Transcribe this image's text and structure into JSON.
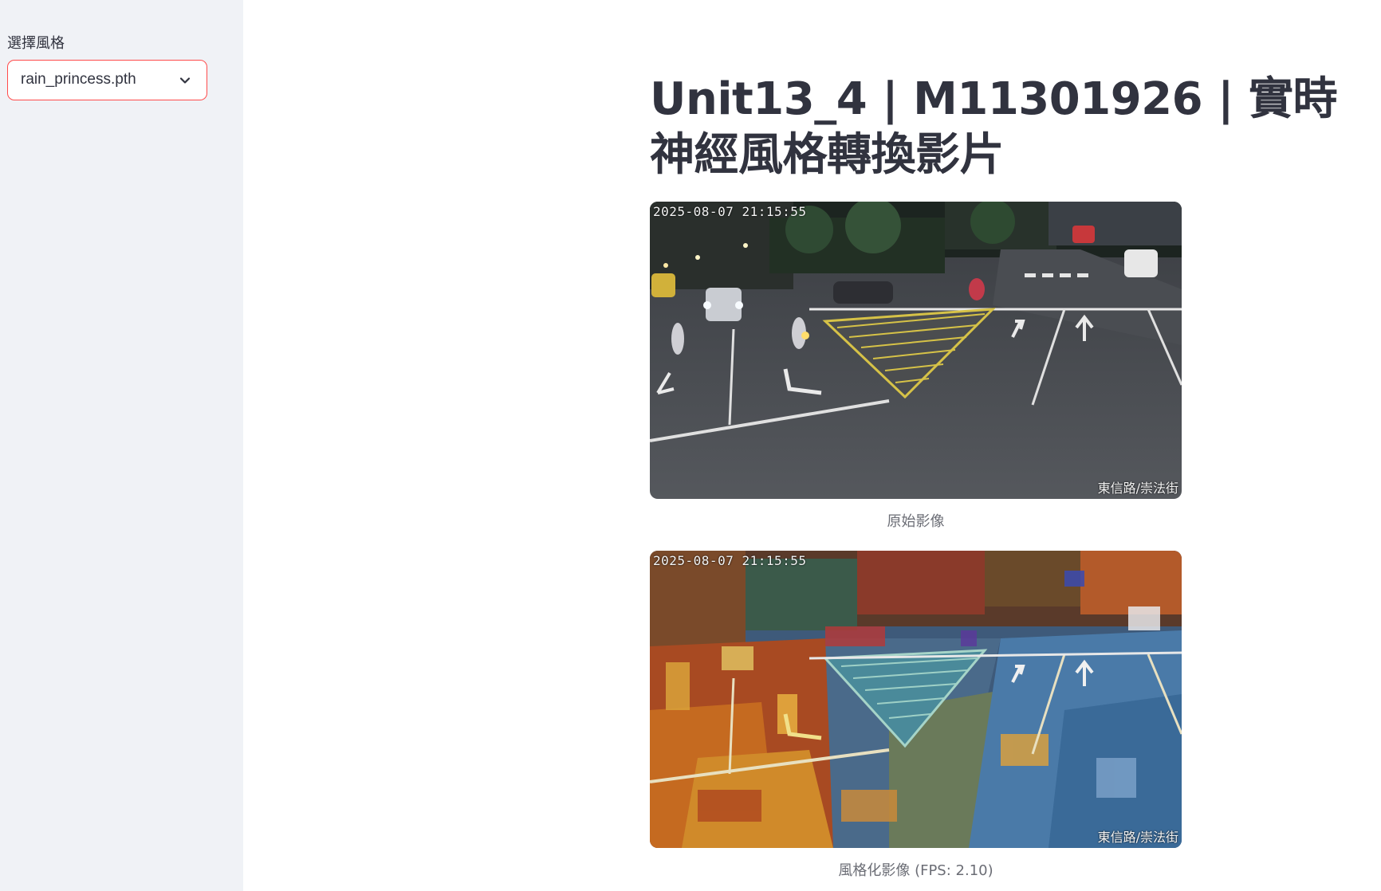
{
  "sidebar": {
    "label": "選擇風格",
    "select": {
      "value": "rain_princess.pth",
      "icon": "chevron-down-icon"
    }
  },
  "main": {
    "title": "Unit13_4 | M11301926 | 實時神經風格轉換影片",
    "original": {
      "timestamp": "2025-08-07  21:15:55",
      "location": "東信路/崇法街",
      "caption": "原始影像"
    },
    "styled": {
      "timestamp": "2025-08-07  21:15:55",
      "location": "東信路/崇法街",
      "caption": "風格化影像 (FPS: 2.10)"
    }
  },
  "colors": {
    "sidebar_bg": "#f0f2f6",
    "accent": "#ff4b4b",
    "text": "#31333f",
    "caption": "#6b6d75"
  }
}
